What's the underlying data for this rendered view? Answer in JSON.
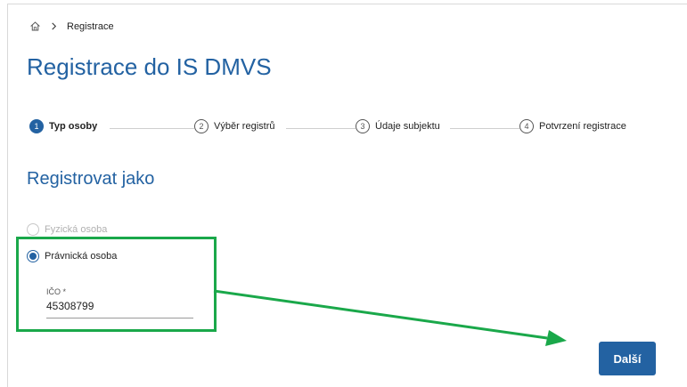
{
  "breadcrumb": {
    "current": "Registrace",
    "home_icon": "home-icon",
    "separator_icon": "chevron-right-icon"
  },
  "page": {
    "title": "Registrace do IS DMVS"
  },
  "stepper": {
    "steps": [
      {
        "number": "1",
        "label": "Typ osoby",
        "active": true
      },
      {
        "number": "2",
        "label": "Výběr registrů",
        "active": false
      },
      {
        "number": "3",
        "label": "Údaje subjektu",
        "active": false
      },
      {
        "number": "4",
        "label": "Potvrzení registrace",
        "active": false
      }
    ]
  },
  "form": {
    "section_title": "Registrovat jako",
    "options": [
      {
        "label": "Fyzická osoba",
        "selected": false,
        "disabled": true
      },
      {
        "label": "Právnická osoba",
        "selected": true,
        "disabled": false
      }
    ],
    "ico": {
      "label": "IČO *",
      "value": "45308799"
    }
  },
  "actions": {
    "next_label": "Další"
  },
  "colors": {
    "primary": "#2362a2",
    "annotation": "#1aa84a"
  }
}
